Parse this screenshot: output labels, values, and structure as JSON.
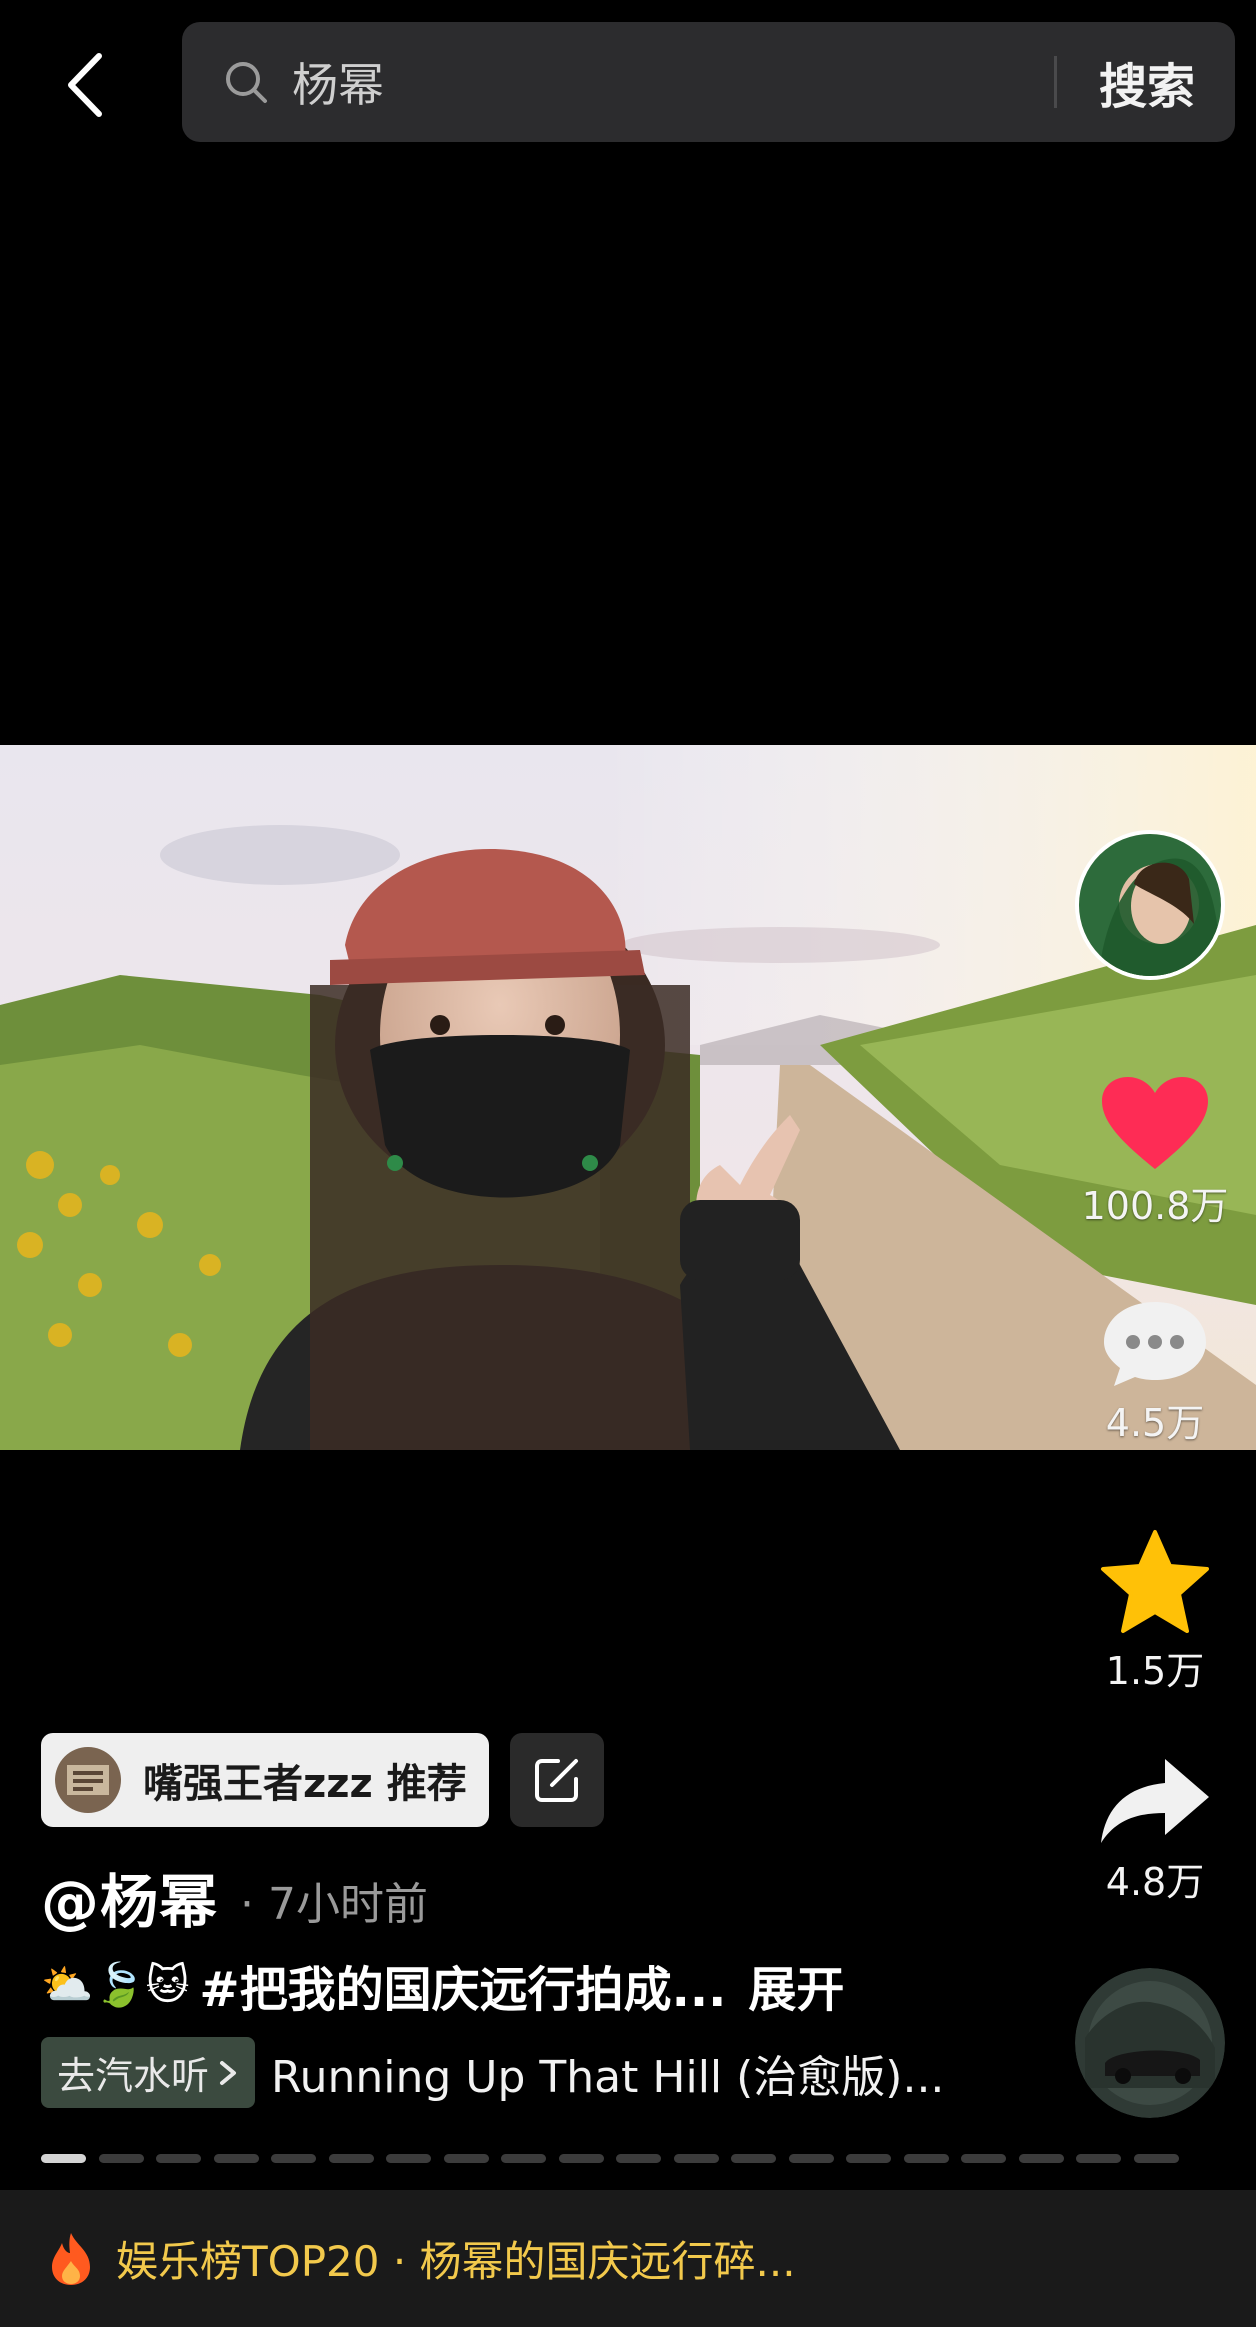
{
  "search": {
    "query": "杨幂",
    "button": "搜索"
  },
  "actions": {
    "likes": "100.8万",
    "comments": "4.5万",
    "favorites": "1.5万",
    "shares": "4.8万"
  },
  "recommend": {
    "label": "嘴强王者zzz 推荐"
  },
  "post": {
    "author": "@杨幂",
    "time": "· 7小时前",
    "emojis": "⛅🍃🐱",
    "caption": "#把我的国庆远行拍成...",
    "expand": "展开"
  },
  "music": {
    "tag": "去汽水听",
    "song": "Running Up That Hill (治愈版)..."
  },
  "banner": {
    "text": "娱乐榜TOP20 · 杨幂的国庆远行碎..."
  },
  "colors": {
    "like": "#fe2c55",
    "star": "#ffc107",
    "banner_text": "#f2c94c"
  },
  "progress": {
    "segments": 20,
    "active_index": 0
  }
}
